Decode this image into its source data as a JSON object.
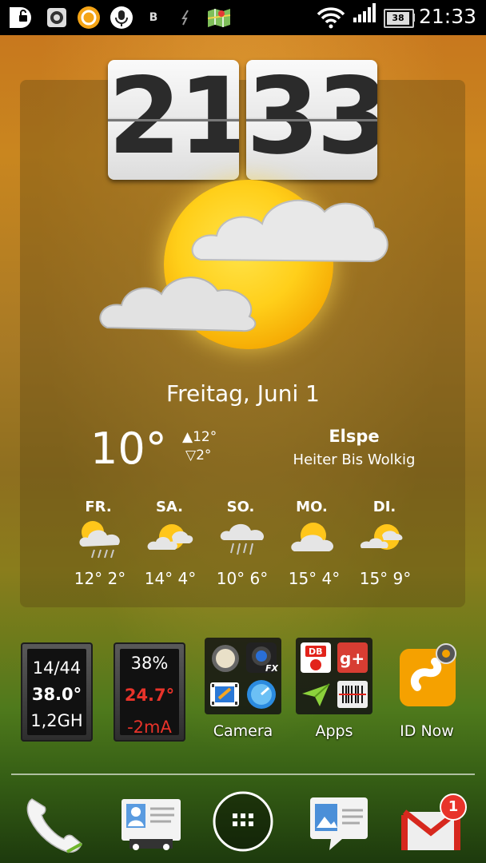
{
  "status_bar": {
    "time": "21:33",
    "battery": "38",
    "notification_letter": "B",
    "icons": [
      "d-app-icon",
      "camera-target-icon",
      "orange-app-icon",
      "microphone-icon",
      "b-icon",
      "usb-icon",
      "maps-icon"
    ],
    "right_icons": [
      "wifi-icon",
      "signal-icon",
      "battery-icon"
    ]
  },
  "clock": {
    "hour": "21",
    "minute": "33"
  },
  "weather": {
    "date": "Freitag, Juni 1",
    "temperature": "10°",
    "high": "▲12°",
    "low": "▽2°",
    "location": "Elspe",
    "condition": "Heiter Bis Wolkig"
  },
  "forecast": [
    {
      "day": "FR.",
      "temps": "12° 2°",
      "icon": "rain-sun-cloud-icon"
    },
    {
      "day": "SA.",
      "temps": "14° 4°",
      "icon": "sun-cloud-icon"
    },
    {
      "day": "SO.",
      "temps": "10° 6°",
      "icon": "rain-cloud-icon"
    },
    {
      "day": "MO.",
      "temps": "15° 4°",
      "icon": "sun-cloud-icon"
    },
    {
      "day": "DI.",
      "temps": "15° 9°",
      "icon": "sun-cloud-icon"
    }
  ],
  "widgets": {
    "cpu": {
      "line1": "14/44",
      "line2": "38.0°",
      "line3": "1,2GH"
    },
    "battery": {
      "line1": "38%",
      "line2": "24.7°",
      "line3": "-2mA"
    }
  },
  "home_icons": [
    {
      "label": "Camera"
    },
    {
      "label": "Apps"
    },
    {
      "label": "ID Now"
    }
  ],
  "dock": [
    "phone-icon",
    "contacts-icon",
    "app-drawer-icon",
    "messages-icon",
    "gmail-icon"
  ],
  "gmail_badge": "1",
  "colors": {
    "accent_red": "#e8332a",
    "status_bg": "#000000"
  }
}
